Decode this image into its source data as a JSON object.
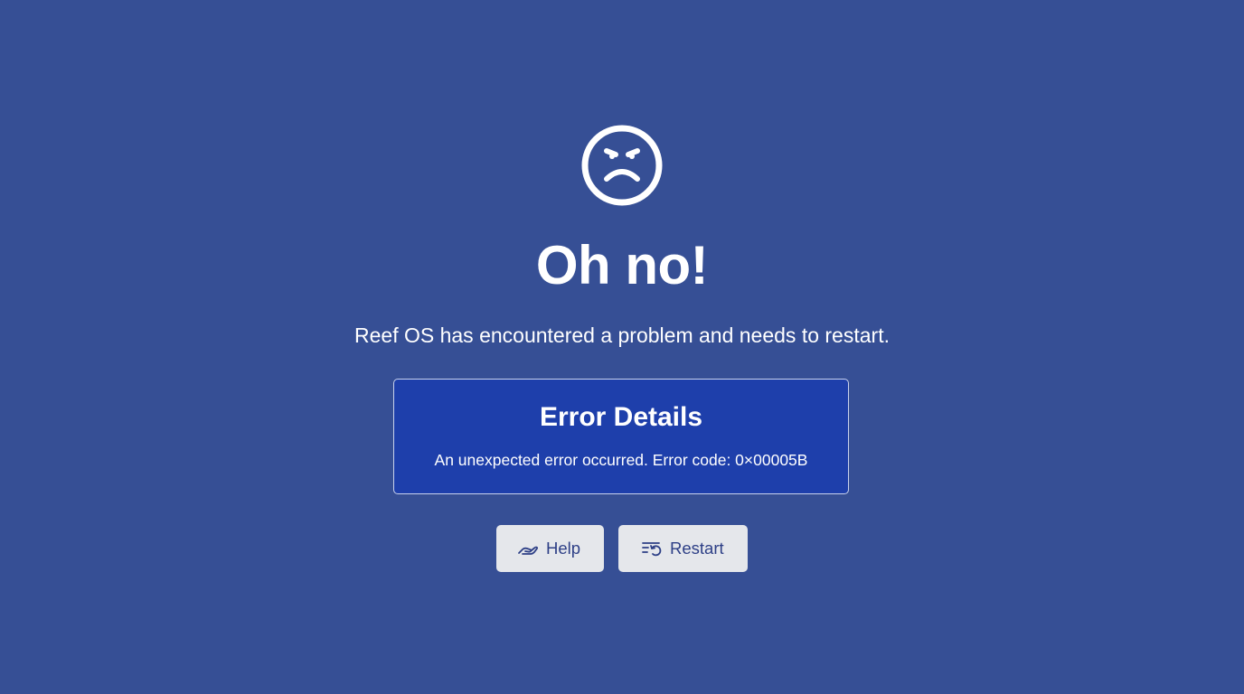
{
  "icons": {
    "face": "angry-face-icon",
    "help": "helping-hand-icon",
    "restart": "restart-list-icon"
  },
  "colors": {
    "background": "#364f95",
    "details_background": "#1e3fab",
    "details_border": "#c9d2ec",
    "button_background": "#e5e7eb",
    "button_text": "#2d3f86",
    "text": "#ffffff"
  },
  "heading": "Oh no!",
  "message": "Reef OS has encountered a problem and needs to restart.",
  "details": {
    "title": "Error Details",
    "text": "An unexpected error occurred. Error code: 0×00005B"
  },
  "buttons": {
    "help": "Help",
    "restart": "Restart"
  }
}
